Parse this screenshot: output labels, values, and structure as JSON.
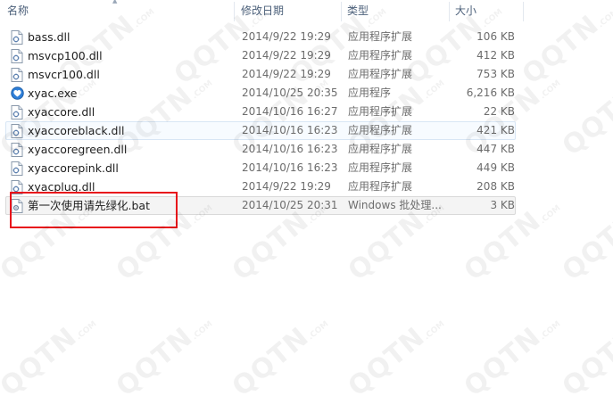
{
  "header": {
    "name": "名称",
    "date": "修改日期",
    "type": "类型",
    "size": "大小"
  },
  "files": [
    {
      "name": "bass.dll",
      "date": "2014/9/22 19:29",
      "type": "应用程序扩展",
      "size": "106 KB",
      "icon": "dll-file-icon"
    },
    {
      "name": "msvcp100.dll",
      "date": "2014/9/22 19:29",
      "type": "应用程序扩展",
      "size": "412 KB",
      "icon": "dll-file-icon"
    },
    {
      "name": "msvcr100.dll",
      "date": "2014/9/22 19:29",
      "type": "应用程序扩展",
      "size": "753 KB",
      "icon": "dll-file-icon"
    },
    {
      "name": "xyac.exe",
      "date": "2014/10/25 20:35",
      "type": "应用程序",
      "size": "6,216 KB",
      "icon": "exe-app-icon"
    },
    {
      "name": "xyaccore.dll",
      "date": "2014/10/16 16:27",
      "type": "应用程序扩展",
      "size": "22 KB",
      "icon": "dll-file-icon"
    },
    {
      "name": "xyaccoreblack.dll",
      "date": "2014/10/16 16:23",
      "type": "应用程序扩展",
      "size": "421 KB",
      "icon": "dll-file-icon"
    },
    {
      "name": "xyaccoregreen.dll",
      "date": "2014/10/16 16:23",
      "type": "应用程序扩展",
      "size": "447 KB",
      "icon": "dll-file-icon"
    },
    {
      "name": "xyaccorepink.dll",
      "date": "2014/10/16 16:23",
      "type": "应用程序扩展",
      "size": "449 KB",
      "icon": "dll-file-icon"
    },
    {
      "name": "xyacplug.dll",
      "date": "2014/9/22 19:29",
      "type": "应用程序扩展",
      "size": "208 KB",
      "icon": "dll-file-icon"
    },
    {
      "name": "第一次使用请先绿化.bat",
      "date": "2014/10/25 20:31",
      "type": "Windows 批处理...",
      "size": "3 KB",
      "icon": "bat-file-icon"
    }
  ],
  "watermark": {
    "text": "QQTN",
    "suffix": ".COM"
  },
  "colors": {
    "highlight": "#e8121b",
    "header_text": "#4c607a",
    "secondary_text": "#6d6d6d"
  }
}
